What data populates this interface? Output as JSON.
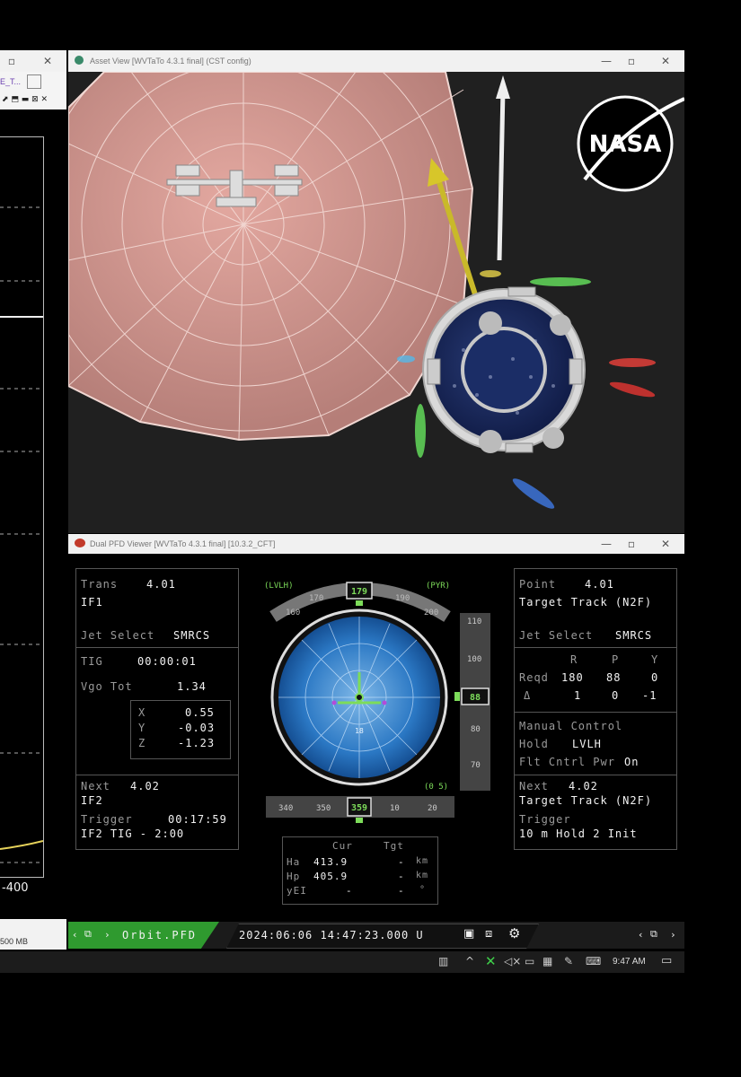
{
  "left_window": {
    "tab_label": "E_T...",
    "axis_tick": "-400",
    "memory_label": "500 MB"
  },
  "asset_window": {
    "title": "Asset View [WVTaTo 4.3.1 final] (CST config)",
    "logo_text": "NASA"
  },
  "pfd_window": {
    "title": "Dual PFD Viewer [WVTaTo 4.3.1 final] [10.3.2_CFT]",
    "left_top": {
      "trans_label": "Trans",
      "trans_value": "4.01",
      "mode": "IF1",
      "jet_select_label": "Jet Select",
      "jet_select_value": "SMRCS"
    },
    "left_mid": {
      "tig_label": "TIG",
      "tig_value": "00:00:01",
      "vgo_label": "Vgo Tot",
      "vgo_value": "1.34",
      "components": [
        {
          "axis": "X",
          "value": "0.55"
        },
        {
          "axis": "Y",
          "value": "-0.03"
        },
        {
          "axis": "Z",
          "value": "-1.23"
        }
      ]
    },
    "left_next": {
      "next_label": "Next",
      "next_value": "4.02",
      "next_mode": "IF2",
      "trigger_label": "Trigger",
      "trigger_value": "00:17:59",
      "trigger_desc": "IF2 TIG - 2:00"
    },
    "adi": {
      "frame_label": "(LVLH)",
      "mode_label": "(PYR)",
      "heading_ticks": [
        "160",
        "170",
        "190",
        "200"
      ],
      "heading_value": "179",
      "pitch_ticks": [
        "110",
        "100",
        "80",
        "70"
      ],
      "pitch_value": "88",
      "roll_label": "(0 5)",
      "roll_ticks": [
        "340",
        "350",
        "10",
        "20"
      ],
      "roll_value": "359",
      "ball_label": "18"
    },
    "orbit_table": {
      "col_cur": "Cur",
      "col_tgt": "Tgt",
      "rows": [
        {
          "label": "Ha",
          "cur": "413.9",
          "tgt": "-",
          "unit": "km"
        },
        {
          "label": "Hp",
          "cur": "405.9",
          "tgt": "-",
          "unit": "km"
        },
        {
          "label": "yEI",
          "cur": "-",
          "tgt": "-",
          "unit": "°"
        }
      ]
    },
    "right_top": {
      "point_label": "Point",
      "point_value": "4.01",
      "target_track": "Target Track (N2F)",
      "jet_select_label": "Jet Select",
      "jet_select_value": "SMRCS"
    },
    "right_att": {
      "hdr_r": "R",
      "hdr_p": "P",
      "hdr_y": "Y",
      "reqd_label": "Reqd",
      "reqd": [
        "180",
        "88",
        "0"
      ],
      "delta_label": "Δ",
      "delta": [
        "1",
        "0",
        "-1"
      ]
    },
    "right_manual": {
      "manual_label": "Manual Control",
      "hold_label": "Hold",
      "hold_value": "LVLH",
      "flt_label": "Flt Cntrl Pwr",
      "flt_value": "On"
    },
    "right_next": {
      "next_label": "Next",
      "next_value": "4.02",
      "target_track": "Target Track (N2F)",
      "trigger_label": "Trigger",
      "trigger_value": "10 m Hold 2 Init"
    },
    "bottom_bar": {
      "nav_label": "Orbit.PFD",
      "timestamp": "2024:06:06 14:47:23.000 U"
    }
  },
  "taskbar": {
    "time": "9:47 AM"
  },
  "colors": {
    "pfd_green": "#7ddc5a",
    "adi_blue": "#2b78c4",
    "shield_pink": "#d79c96",
    "tan_bar": "#2f9a2f"
  }
}
